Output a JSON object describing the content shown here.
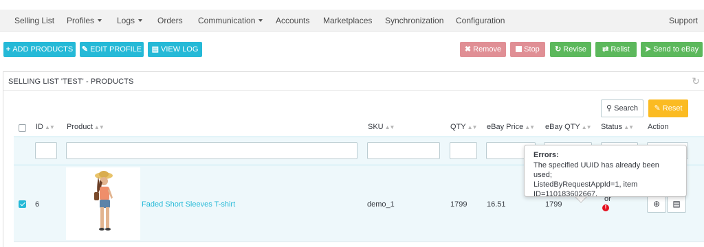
{
  "nav": {
    "items": [
      {
        "label": "Selling List",
        "dropdown": false
      },
      {
        "label": "Profiles",
        "dropdown": true
      },
      {
        "label": "Logs",
        "dropdown": true
      },
      {
        "label": "Orders",
        "dropdown": false
      },
      {
        "label": "Communication",
        "dropdown": true
      },
      {
        "label": "Accounts",
        "dropdown": false
      },
      {
        "label": "Marketplaces",
        "dropdown": false
      },
      {
        "label": "Synchronization",
        "dropdown": false
      },
      {
        "label": "Configuration",
        "dropdown": false
      }
    ],
    "support": "Support"
  },
  "toolbar": {
    "add_products": "ADD PRODUCTS",
    "edit_profile": "EDIT PROFILE",
    "view_log": "VIEW LOG",
    "remove": "Remove",
    "stop": "Stop",
    "revise": "Revise",
    "relist": "Relist",
    "send_to_ebay": "Send to eBay"
  },
  "panel": {
    "title": "SELLING LIST 'TEST' - PRODUCTS",
    "search": "Search",
    "reset": "Reset"
  },
  "table": {
    "headers": {
      "id": "ID",
      "product": "Product",
      "sku": "SKU",
      "qty": "QTY",
      "ebay_price": "eBay Price",
      "ebay_qty": "eBay QTY",
      "status": "Status",
      "action": "Action"
    },
    "rows": [
      {
        "checked": true,
        "id": "6",
        "product": "Faded Short Sleeves T-shirt",
        "sku": "demo_1",
        "qty": "1799",
        "ebay_price": "16.51",
        "ebay_qty": "1799",
        "status": "Error",
        "status_visible_fragment": "or"
      }
    ]
  },
  "tooltip": {
    "title": "Errors:",
    "lines": [
      "The specified UUID has already been used;",
      "ListedByRequestAppId=1, item",
      "ID=110183602667."
    ]
  },
  "colors": {
    "primary": "#25b9d7",
    "danger_light": "#e08f95",
    "success": "#5cb85c",
    "warning": "#fbbb22",
    "error": "#e4101f"
  }
}
